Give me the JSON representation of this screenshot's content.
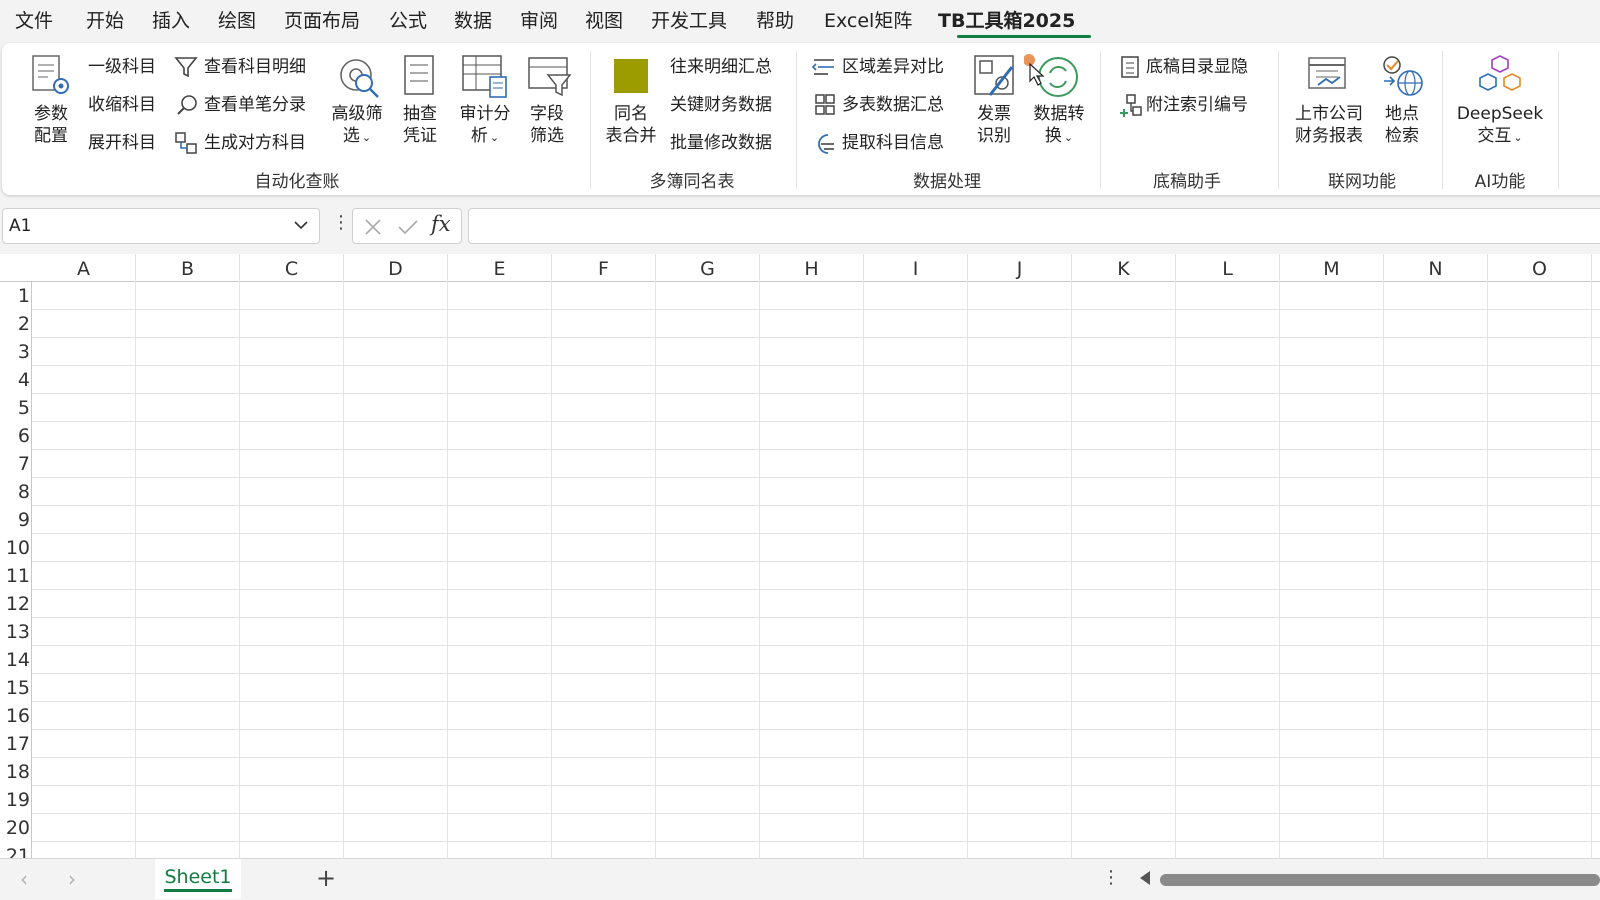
{
  "menu": {
    "items": [
      "文件",
      "开始",
      "插入",
      "绘图",
      "页面布局",
      "公式",
      "数据",
      "审阅",
      "视图",
      "开发工具",
      "帮助",
      "Excel矩阵",
      "TB工具箱2025"
    ],
    "active": "TB工具箱2025"
  },
  "ribbon": {
    "auto": {
      "param_config": [
        "参数",
        "配置"
      ],
      "level1": "一级科目",
      "collapse": "收缩科目",
      "expand": "展开科目",
      "view_detail": "查看科目明细",
      "view_entry": "查看单笔分录",
      "gen_opposite": "生成对方科目",
      "adv_filter": [
        "高级筛",
        "选"
      ],
      "sample": [
        "抽查",
        "凭证"
      ],
      "audit_analysis": [
        "审计分",
        "析"
      ],
      "field_filter": [
        "字段",
        "筛选"
      ],
      "group_label": "自动化查账"
    },
    "multi": {
      "merge": [
        "同名",
        "表合并"
      ],
      "current_account": "往来明细汇总",
      "key_finance": "关键财务数据",
      "batch_modify": "批量修改数据",
      "group_label": "多簿同名表",
      "swatch_color": "#9c9c00"
    },
    "data": {
      "region_diff": "区域差异对比",
      "multi_sum": "多表数据汇总",
      "extract_subject": "提取科目信息",
      "invoice": [
        "发票",
        "识别"
      ],
      "convert": [
        "数据转",
        "换"
      ],
      "group_label": "数据处理"
    },
    "draft": {
      "dir_toggle": "底稿目录显隐",
      "note_index": "附注索引编号",
      "group_label": "底稿助手"
    },
    "online": {
      "listed": [
        "上市公司",
        "财务报表"
      ],
      "location": [
        "地点",
        "检索"
      ],
      "group_label": "联网功能"
    },
    "ai": {
      "deepseek": [
        "DeepSeek",
        "交互"
      ],
      "group_label": "AI功能"
    }
  },
  "formula": {
    "namebox": "A1",
    "fx": "fx",
    "value": ""
  },
  "grid": {
    "columns": [
      "A",
      "B",
      "C",
      "D",
      "E",
      "F",
      "G",
      "H",
      "I",
      "J",
      "K",
      "L",
      "M",
      "N",
      "O"
    ],
    "rows": [
      "1",
      "2",
      "3",
      "4",
      "5",
      "6",
      "7",
      "8",
      "9",
      "10",
      "11",
      "12",
      "13",
      "14",
      "15",
      "16",
      "17",
      "18",
      "19",
      "20",
      "21"
    ]
  },
  "sheets": {
    "tabs": [
      "Sheet1"
    ],
    "add": "+"
  },
  "colors": {
    "accent": "#107c41"
  }
}
